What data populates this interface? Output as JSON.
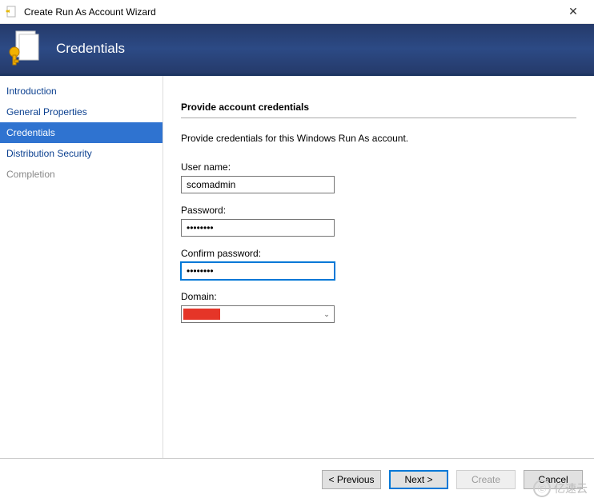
{
  "window": {
    "title": "Create Run As Account Wizard",
    "close_glyph": "✕"
  },
  "banner": {
    "title": "Credentials"
  },
  "sidebar": {
    "items": [
      {
        "label": "Introduction"
      },
      {
        "label": "General Properties"
      },
      {
        "label": "Credentials"
      },
      {
        "label": "Distribution Security"
      },
      {
        "label": "Completion"
      }
    ]
  },
  "content": {
    "heading": "Provide account credentials",
    "instruction": "Provide credentials for this Windows Run As account.",
    "username_label": "User name:",
    "username_value": "scomadmin",
    "password_label": "Password:",
    "password_value": "••••••••",
    "confirm_label": "Confirm password:",
    "confirm_value": "••••••••",
    "domain_label": "Domain:",
    "domain_arrow": "⌄"
  },
  "footer": {
    "previous": "< Previous",
    "next": "Next >",
    "create": "Create",
    "cancel": "Cancel"
  },
  "watermark": {
    "glyph": "Ⓔ",
    "text": "亿速云"
  }
}
